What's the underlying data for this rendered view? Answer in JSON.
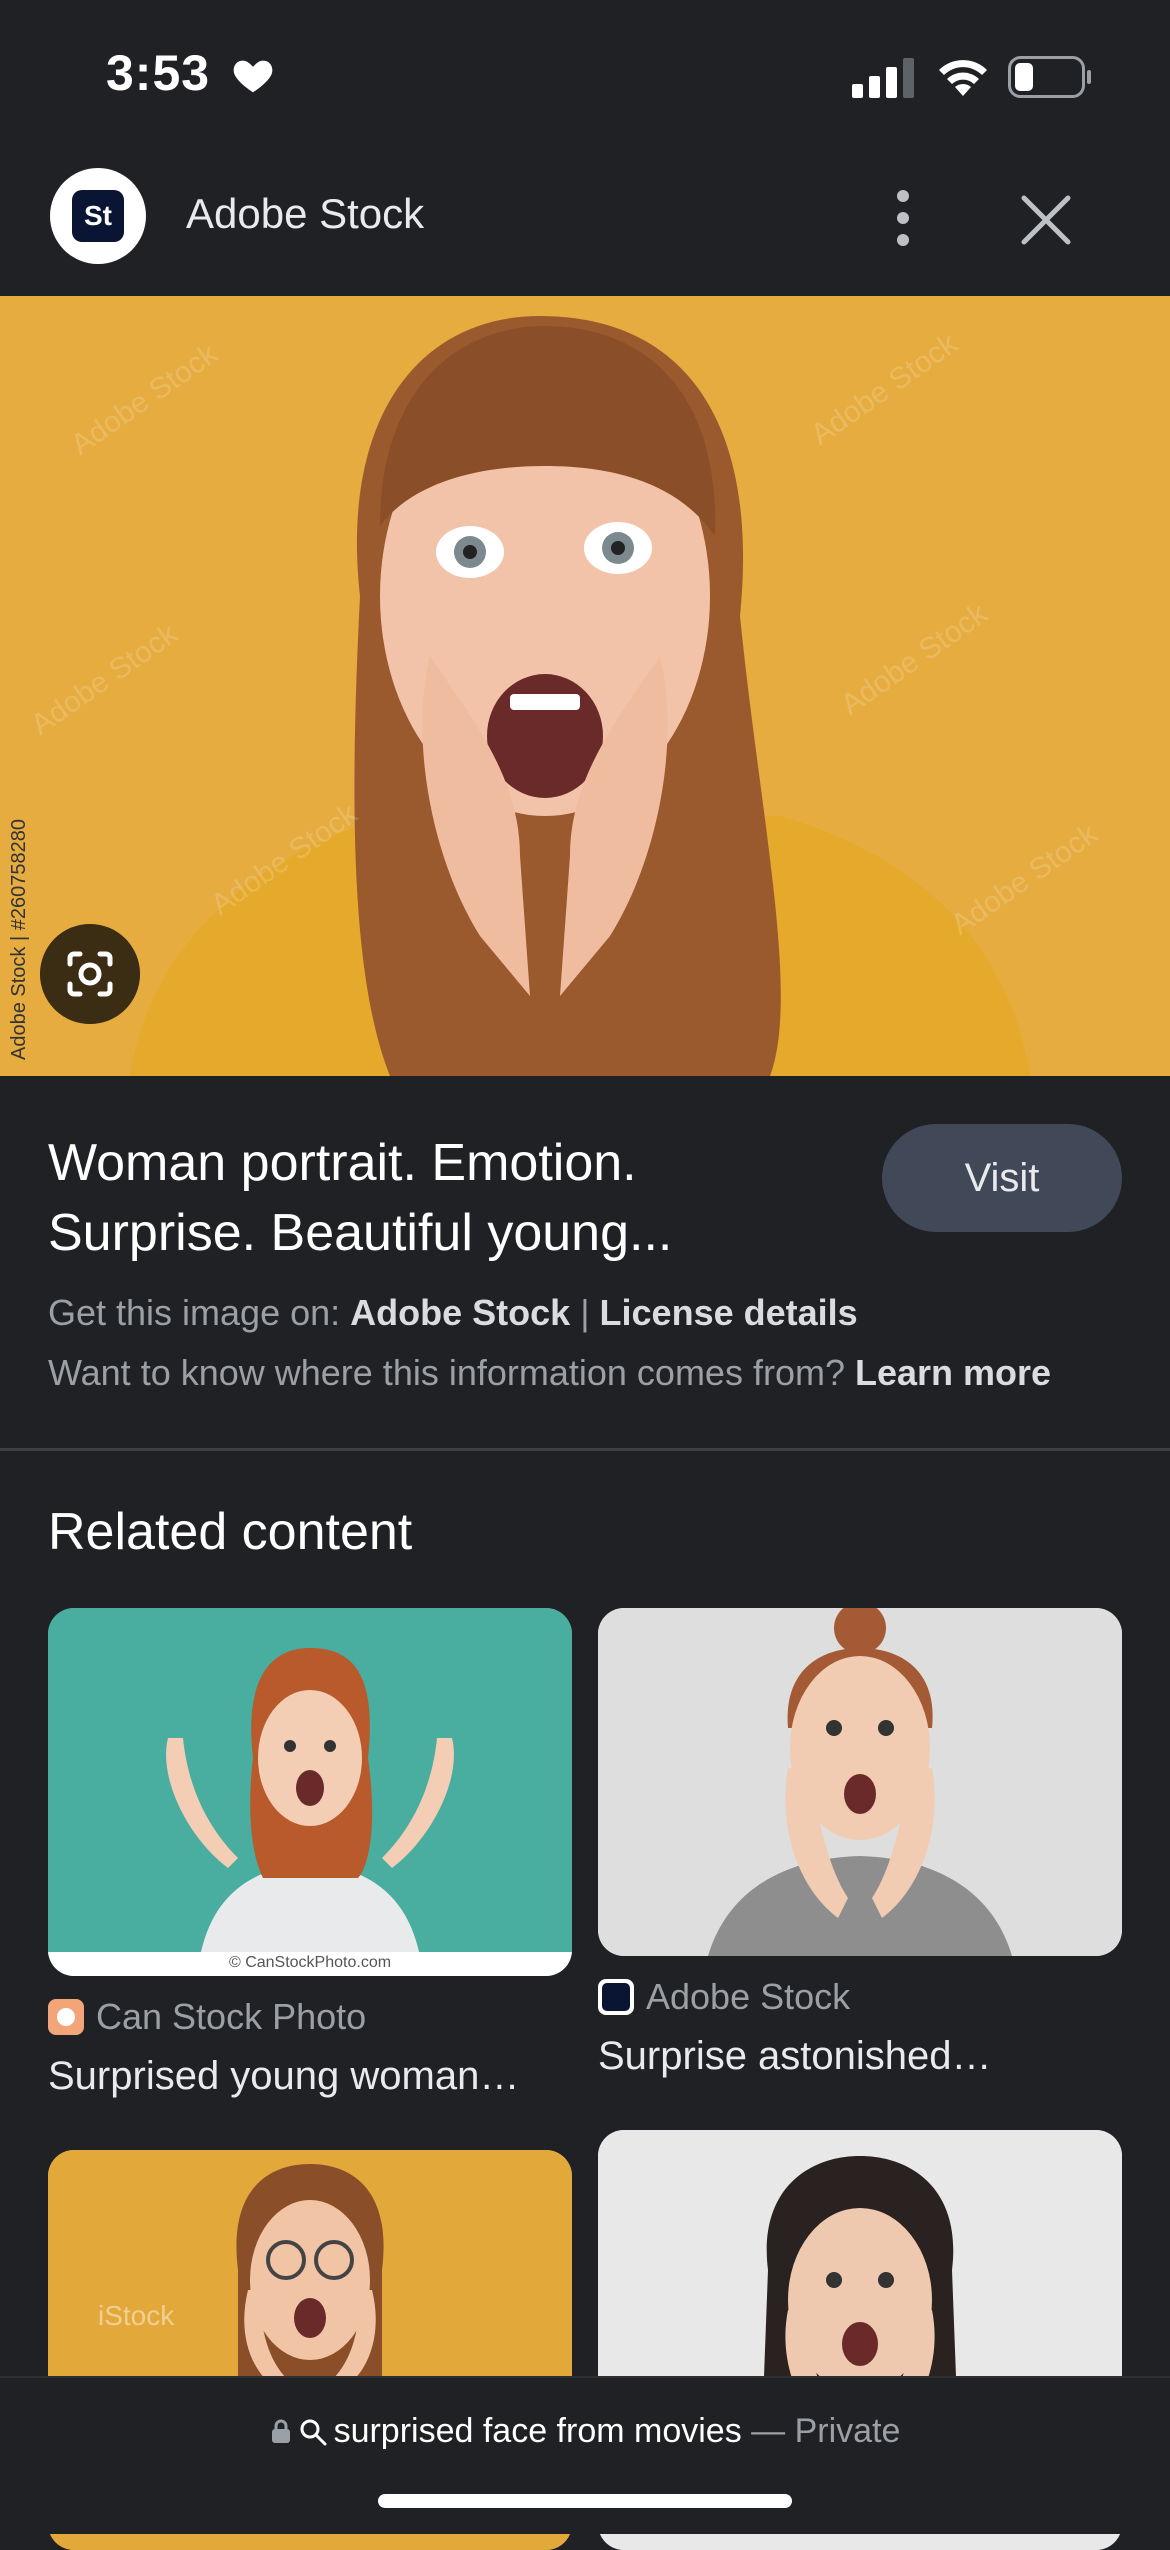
{
  "status_bar": {
    "time": "3:53"
  },
  "header": {
    "site_name": "Adobe Stock",
    "logo_text": "St"
  },
  "main_image": {
    "credit": "Adobe Stock | #260758280"
  },
  "info": {
    "title_line1": "Woman portrait. Emotion.",
    "title_line2": "Surprise. Beautiful young...",
    "visit_label": "Visit",
    "source_prefix": "Get this image on: ",
    "source_name": "Adobe Stock",
    "source_sep": " | ",
    "license_label": "License details",
    "info_prefix": "Want to know where this information comes from? ",
    "learn_more": "Learn more"
  },
  "related": {
    "heading": "Related content",
    "items": [
      {
        "source": "Can Stock Photo",
        "title": "Surprised young woman…",
        "watermark": "© CanStockPhoto.com"
      },
      {
        "source": "Adobe Stock",
        "title": "Surprise astonished…"
      },
      {
        "watermark": "iStock"
      },
      {}
    ]
  },
  "bottom_bar": {
    "query": "surprised face from movies",
    "separator": " — ",
    "mode": "Private"
  },
  "colors": {
    "background": "#202124",
    "visit_button": "#414858",
    "image_bg": "#e6ac3f"
  }
}
